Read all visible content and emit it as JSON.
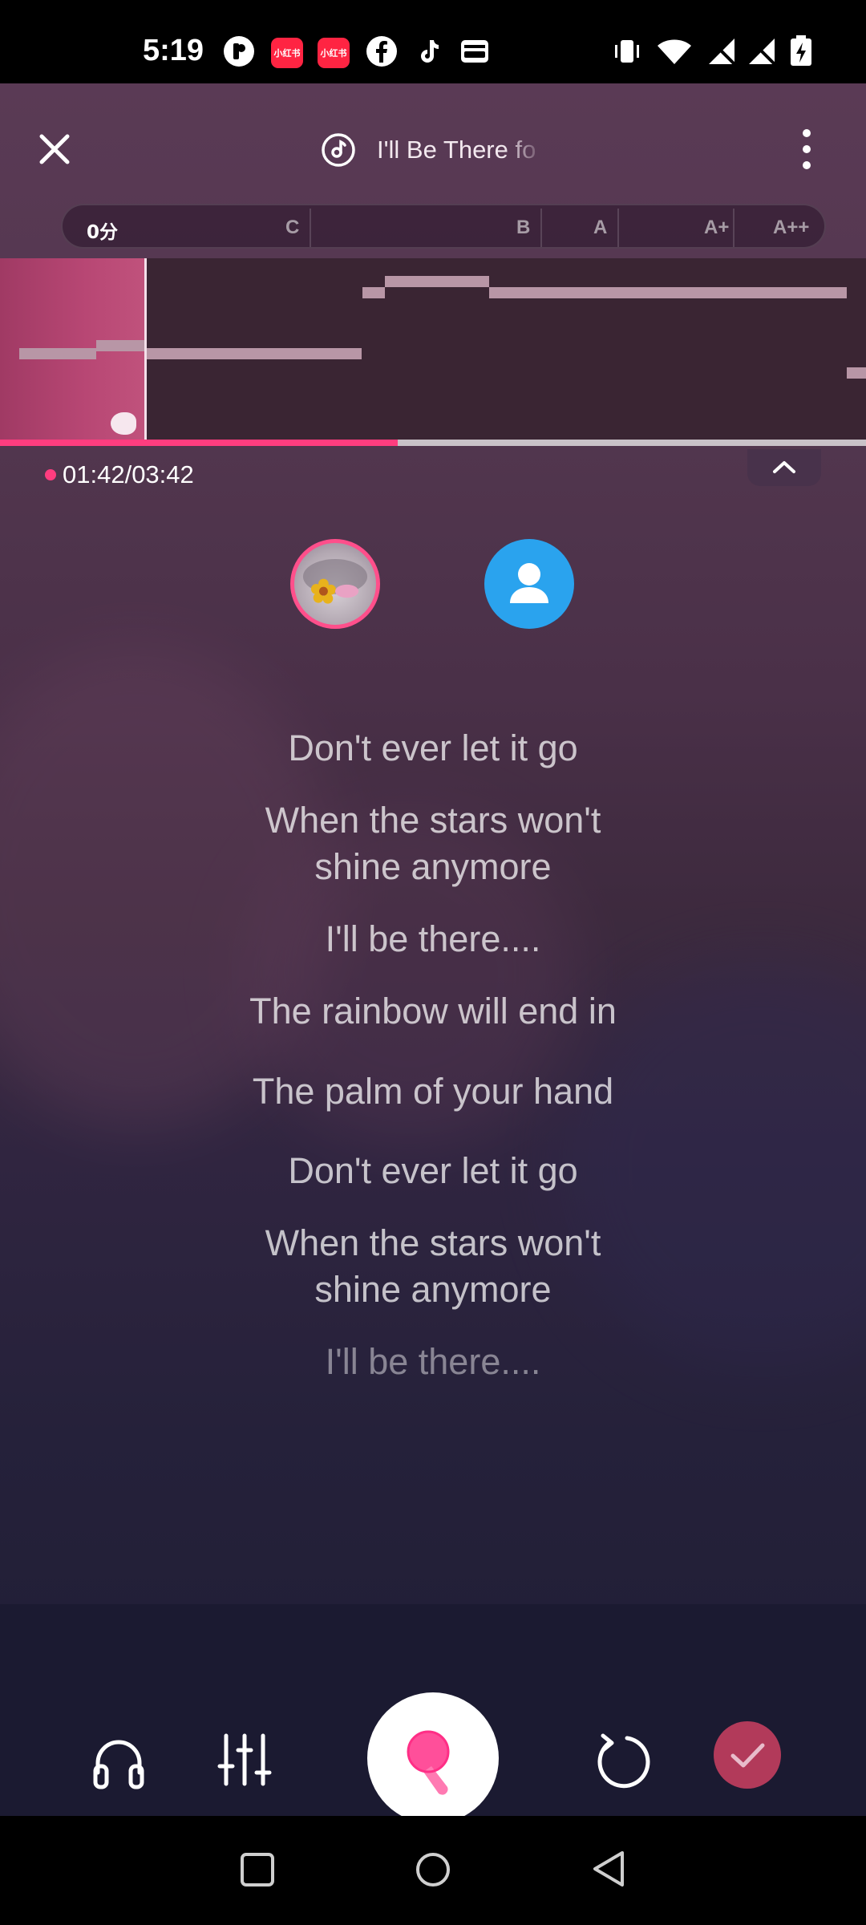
{
  "status_bar": {
    "time": "5:19",
    "app_badges": [
      "小红书",
      "小红书"
    ]
  },
  "header": {
    "close_icon": "close-icon",
    "song_title": "I'll Be There fo",
    "more_icon": "more-vertical-icon"
  },
  "score": {
    "current": "0分",
    "grades": [
      "C",
      "B",
      "A",
      "A+",
      "A++"
    ]
  },
  "playback": {
    "elapsed_total": "01:42/03:42",
    "progress_fraction": 0.459
  },
  "lyrics": [
    "Don't ever let it go",
    "When the stars won't",
    "shine anymore",
    "I'll be there....",
    "The rainbow will end in",
    "The palm of your hand",
    "Don't ever let it go",
    "When the stars won't",
    "shine anymore",
    "I'll be there...."
  ],
  "controls": {
    "headphones_icon": "headphones-icon",
    "mixer_icon": "sliders-icon",
    "record_icon": "microphone-icon",
    "restart_icon": "restart-icon",
    "done_icon": "check-icon"
  },
  "colors": {
    "accent": "#ff3d7f",
    "done": "#b23a5a",
    "partner_avatar": "#2aa3ee"
  }
}
